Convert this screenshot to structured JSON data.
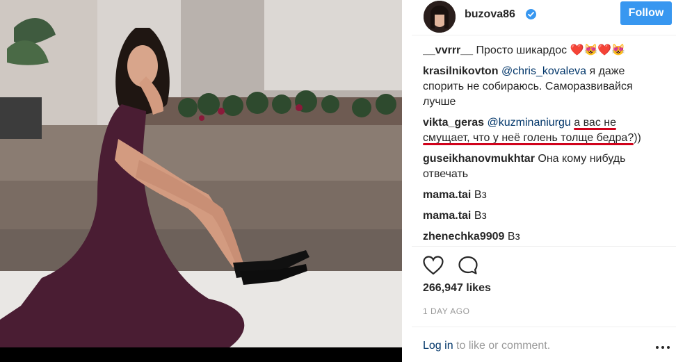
{
  "post": {
    "username": "buzova86",
    "follow_label": "Follow",
    "likes": "266,947 likes",
    "timestamp": "1 DAY AGO",
    "login_link": "Log in",
    "login_suffix": " to like or comment."
  },
  "comments": [
    {
      "user": "__vvrrr__",
      "pre": "",
      "mention": "",
      "text": " Просто шикардос ",
      "emoji": "❤️😻❤️😻"
    },
    {
      "user": "krasilnikovton",
      "pre": " ",
      "mention": "@chris_kovaleva",
      "text": " я даже спорить не собираюсь. Саморазвивайся лучше"
    },
    {
      "user": "vikta_geras",
      "pre": " ",
      "mention": "@kuzminaniurgu",
      "text_a": " ",
      "underlined_1": "а вас не",
      "underlined_2": "смущает, что у неё голень толще бедра?",
      "text_b": "))"
    },
    {
      "user": "guseikhanovmukhtar",
      "pre": " ",
      "mention": "",
      "text": "Она кому нибудь отвечать"
    },
    {
      "user": "mama.tai",
      "pre": " ",
      "mention": "",
      "text": "Вз"
    },
    {
      "user": "mama.tai",
      "pre": " ",
      "mention": "",
      "text": "Вз"
    },
    {
      "user": "zhenechka9909",
      "pre": " ",
      "mention": "",
      "text": "Вз"
    }
  ],
  "icons": {
    "verified": "verified-badge-icon",
    "like": "heart-icon",
    "comment": "comment-bubble-icon",
    "more": "more-dots-icon"
  },
  "colors": {
    "accent": "#3897f0",
    "link": "#003569",
    "underline": "#d0021b",
    "muted": "#999999"
  }
}
